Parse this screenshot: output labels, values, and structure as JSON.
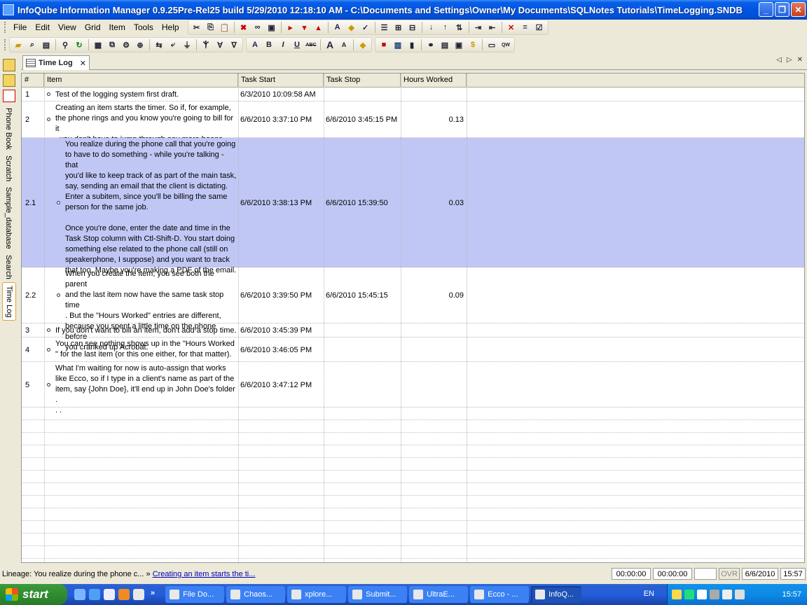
{
  "window": {
    "title": "InfoQube Information Manager 0.9.25Pre-Rel25  build 5/29/2010 12:18:10 AM - C:\\Documents and Settings\\Owner\\My Documents\\SQLNotes Tutorials\\TimeLogging.SNDB",
    "minimize": "_",
    "restore": "❐",
    "close": "✕"
  },
  "menu": [
    "File",
    "Edit",
    "View",
    "Grid",
    "Item",
    "Tools",
    "Help"
  ],
  "side_tabs": [
    "Phone Book",
    "Scratch",
    "Sample_database",
    "Search",
    "Time Log"
  ],
  "doc_tab": {
    "label": "Time Log",
    "close": "✕"
  },
  "grid": {
    "headers": [
      "#",
      "Item",
      "Task Start",
      "Task Stop",
      "Hours Worked"
    ],
    "rows": [
      {
        "num": "1",
        "item": "Test of the logging system first draft.",
        "start": "6/3/2010 10:09:58 AM",
        "stop": "",
        "hours": ""
      },
      {
        "num": "2",
        "item": "Creating an item starts the timer. So if, for example,\nthe phone rings and you know you're going to bill for it\n, you don't have to jump through any more hoops.",
        "start": "6/6/2010 3:37:10 PM",
        "stop": "6/6/2010 3:45:15 PM",
        "hours": "0.13"
      },
      {
        "num": "2.1",
        "item": "You realize during the phone call that you're going\nto have to do something - while you're talking - that\nyou'd like to keep track of as part of the main task,\nsay, sending an email that the client is dictating.\nEnter a subitem, since you'll be billing the same\nperson for the same job.\n\nOnce you're done, enter the date and time in the\nTask Stop column with Ctl-Shift-D. You start doing\nsomething else related to the phone call (still on\nspeakerphone, I suppose) and you want to track\nthat too. Maybe you're making a PDF of the email.",
        "start": "6/6/2010 3:38:13 PM",
        "stop": "6/6/2010 15:39:50",
        "hours": "0.03"
      },
      {
        "num": "2.2",
        "item": "When you create the item, you see both the parent\nand the last item now have the same task stop time\n. But the \"Hours Worked\" entries are different,\nbecause you spent a little time on the phone before\nyou cranked up Acrobat.",
        "start": "6/6/2010 3:39:50 PM",
        "stop": "6/6/2010 15:45:15",
        "hours": "0.09"
      },
      {
        "num": "3",
        "item": "If you don't want to bill an item, don't add a stop time.",
        "start": "6/6/2010 3:45:39 PM",
        "stop": "",
        "hours": ""
      },
      {
        "num": "4",
        "item": "You can see nothing shows up in the \"Hours Worked\n\" for the last item (or this one either, for that matter).",
        "start": "6/6/2010 3:46:05 PM",
        "stop": "",
        "hours": ""
      },
      {
        "num": "5",
        "item": "What I'm waiting for now is auto-assign that works\nlike Ecco, so if I type in a client's name as part of the\nitem, say {John Doe}, it'll end up in John Doe's folder .\n. .",
        "start": "6/6/2010 3:47:12 PM",
        "stop": "",
        "hours": ""
      }
    ]
  },
  "status": {
    "lineage_prefix": "Lineage: You realize during the phone c... »",
    "lineage_link": "Creating an item starts the ti...",
    "timer1": "00:00:00",
    "timer2": "00:00:00",
    "ovr": "OVR",
    "date": "6/6/2010",
    "time": "15:57"
  },
  "taskbar": {
    "start": "start",
    "more": "»",
    "tasks": [
      "File Do...",
      "Chaos...",
      "xplore...",
      "Submit...",
      "UltraE...",
      "Ecco - ...",
      "InfoQ..."
    ],
    "lang": "EN",
    "clock": "15:57"
  }
}
